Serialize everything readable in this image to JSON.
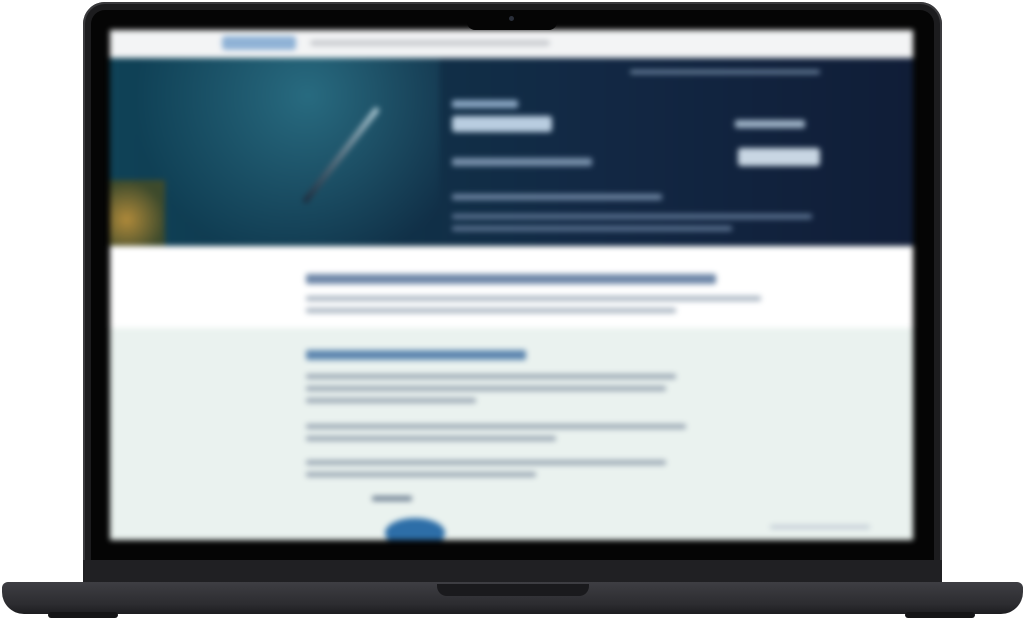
{
  "device": {
    "type": "laptop",
    "color": "#1c1c1e"
  },
  "screen": {
    "blurred": true,
    "colors": {
      "hero_dark": "#101d37",
      "hero_teal": "#0f4257",
      "content_bg": "#eaf2ef",
      "heading_blue": "#5e87b0",
      "accent_blob": "#2d6ea8"
    }
  }
}
